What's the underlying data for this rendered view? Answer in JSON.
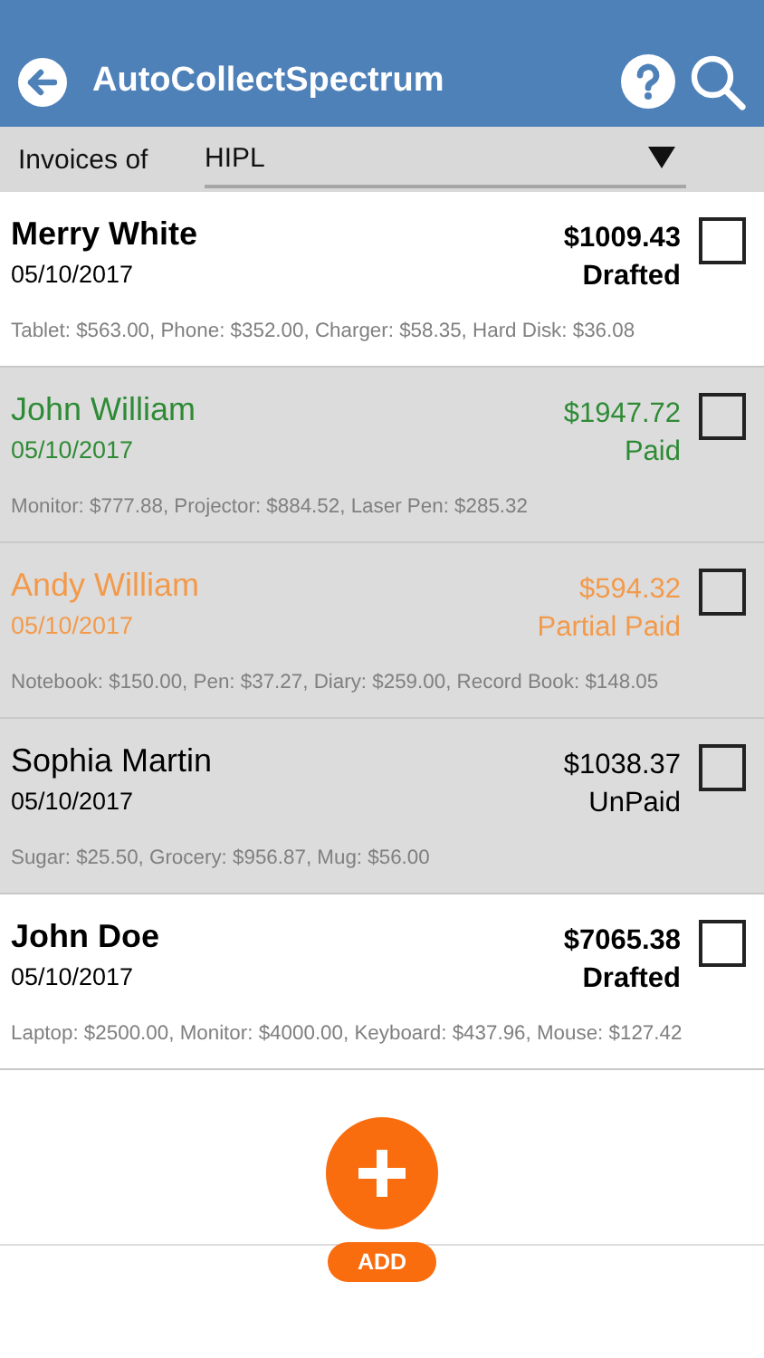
{
  "header": {
    "title": "AutoCollectSpectrum"
  },
  "filter": {
    "label": "Invoices of",
    "value": "HIPL"
  },
  "invoices": [
    {
      "name": "Merry White",
      "date": "05/10/2017",
      "amount": "$1009.43",
      "status": "Drafted",
      "kind": "drafted",
      "checked": false,
      "items": "Tablet: $563.00, Phone: $352.00, Charger: $58.35, Hard Disk: $36.08"
    },
    {
      "name": "John William",
      "date": "05/10/2017",
      "amount": "$1947.72",
      "status": "Paid",
      "kind": "paid",
      "checked": false,
      "items": "Monitor: $777.88, Projector: $884.52, Laser Pen: $285.32"
    },
    {
      "name": "Andy William",
      "date": "05/10/2017",
      "amount": "$594.32",
      "status": "Partial Paid",
      "kind": "partial",
      "checked": false,
      "items": "Notebook: $150.00, Pen: $37.27, Diary: $259.00, Record Book: $148.05"
    },
    {
      "name": "Sophia Martin",
      "date": "05/10/2017",
      "amount": "$1038.37",
      "status": "UnPaid",
      "kind": "unpaid",
      "checked": false,
      "items": "Sugar: $25.50, Grocery: $956.87, Mug: $56.00"
    },
    {
      "name": "John Doe",
      "date": "05/10/2017",
      "amount": "$7065.38",
      "status": "Drafted",
      "kind": "drafted",
      "checked": false,
      "items": "Laptop: $2500.00, Monitor: $4000.00, Keyboard: $437.96, Mouse: $127.42"
    }
  ],
  "add_button": {
    "label": "ADD"
  }
}
